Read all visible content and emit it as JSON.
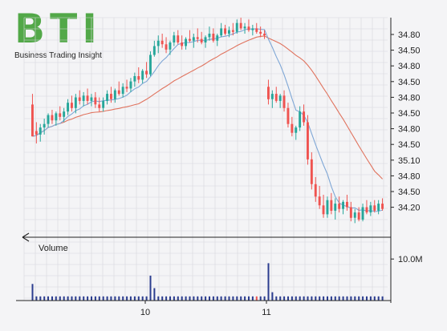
{
  "brand": {
    "logo_text": "BTI",
    "tagline": "Business Trading Insight",
    "logo_color": "#52a848"
  },
  "colors": {
    "background": "#f4f4f6",
    "grid": "#d6d6dc",
    "up_candle": "#26a69a",
    "down_candle": "#ef5350",
    "sma_fast": "#7fa7d6",
    "sma_slow": "#e0735e",
    "volume_bar": "#2b3d8f",
    "volume_bar_down": "#ef5350",
    "axis_line": "#222222"
  },
  "chart_data": {
    "type": "candlestick",
    "price_axis": {
      "tick_labels": [
        "34.80",
        "34.50",
        "34.80",
        "34.50",
        "34.80",
        "34.50",
        "34.80",
        "34.50",
        "35.10",
        "34.80",
        "34.50",
        "34.20"
      ],
      "ylim": [
        0,
        11
      ]
    },
    "x_axis": {
      "tick_labels": [
        "10",
        "11"
      ],
      "tick_positions": [
        40,
        80
      ],
      "xlim": [
        0,
        120
      ]
    },
    "volume_panel": {
      "label": "Volume",
      "tick_label": "10.0M",
      "tick_value": 10.0
    },
    "candles": [
      [
        7.0,
        7.6,
        5.5,
        5.2
      ],
      [
        5.5,
        6.0,
        4.8,
        5.3
      ],
      [
        5.3,
        5.9,
        4.9,
        5.7
      ],
      [
        5.7,
        6.2,
        5.3,
        5.9
      ],
      [
        5.9,
        6.5,
        5.7,
        6.4
      ],
      [
        6.4,
        6.7,
        5.9,
        6.1
      ],
      [
        6.1,
        6.6,
        5.8,
        6.5
      ],
      [
        6.5,
        6.9,
        6.1,
        6.3
      ],
      [
        6.3,
        6.8,
        6.0,
        6.6
      ],
      [
        6.6,
        7.3,
        6.4,
        7.1
      ],
      [
        7.1,
        7.5,
        6.6,
        6.8
      ],
      [
        6.8,
        7.6,
        6.5,
        7.4
      ],
      [
        7.4,
        7.8,
        7.0,
        7.2
      ],
      [
        7.2,
        7.7,
        6.9,
        7.5
      ],
      [
        7.5,
        7.9,
        7.0,
        7.2
      ],
      [
        7.2,
        7.6,
        6.9,
        7.4
      ],
      [
        7.4,
        7.7,
        6.8,
        7.0
      ],
      [
        7.0,
        7.4,
        6.6,
        6.8
      ],
      [
        6.8,
        7.4,
        6.6,
        7.2
      ],
      [
        7.2,
        7.8,
        7.0,
        7.6
      ],
      [
        7.6,
        8.0,
        7.1,
        7.3
      ],
      [
        7.3,
        7.9,
        7.1,
        7.8
      ],
      [
        7.8,
        8.3,
        7.5,
        7.6
      ],
      [
        7.6,
        8.2,
        7.4,
        8.0
      ],
      [
        8.0,
        8.4,
        7.7,
        7.9
      ],
      [
        7.9,
        8.5,
        7.7,
        8.3
      ],
      [
        8.3,
        8.8,
        8.0,
        8.6
      ],
      [
        8.6,
        9.1,
        8.2,
        8.4
      ],
      [
        8.4,
        9.0,
        8.2,
        8.9
      ],
      [
        8.9,
        9.4,
        8.5,
        8.7
      ],
      [
        8.7,
        10.0,
        8.6,
        9.8
      ],
      [
        9.8,
        10.6,
        9.7,
        10.3
      ],
      [
        10.3,
        10.9,
        9.9,
        10.6
      ],
      [
        10.6,
        11.0,
        10.2,
        10.4
      ],
      [
        10.4,
        10.8,
        9.9,
        10.1
      ],
      [
        10.1,
        10.6,
        9.8,
        10.5
      ],
      [
        10.5,
        11.1,
        10.3,
        10.9
      ],
      [
        10.9,
        11.2,
        10.4,
        10.5
      ],
      [
        10.5,
        10.9,
        10.1,
        10.3
      ],
      [
        10.3,
        10.8,
        10.1,
        10.7
      ],
      [
        10.7,
        11.2,
        10.5,
        10.6
      ],
      [
        10.6,
        11.0,
        10.2,
        10.8
      ],
      [
        10.8,
        11.3,
        10.5,
        10.7
      ],
      [
        10.7,
        11.1,
        10.4,
        10.5
      ],
      [
        10.5,
        10.9,
        10.2,
        10.8
      ],
      [
        10.8,
        11.4,
        10.6,
        11.0
      ],
      [
        11.0,
        11.3,
        10.5,
        10.6
      ],
      [
        10.6,
        11.0,
        10.3,
        10.9
      ],
      [
        10.9,
        11.6,
        10.8,
        11.3
      ],
      [
        11.3,
        11.5,
        10.9,
        11.0
      ],
      [
        11.0,
        11.4,
        10.8,
        11.2
      ],
      [
        11.2,
        11.6,
        10.9,
        11.1
      ],
      [
        11.1,
        11.8,
        11.0,
        11.6
      ],
      [
        11.6,
        11.9,
        11.2,
        11.3
      ],
      [
        11.3,
        11.6,
        11.0,
        11.4
      ],
      [
        11.4,
        11.8,
        11.1,
        11.2
      ],
      [
        11.2,
        11.5,
        10.9,
        11.3
      ],
      [
        11.3,
        11.6,
        11.0,
        11.1
      ],
      [
        11.1,
        11.4,
        10.8,
        11.0
      ],
      [
        11.0,
        11.2,
        10.7,
        10.9
      ],
      [
        8.0,
        8.4,
        7.0,
        7.3
      ],
      [
        7.3,
        7.8,
        6.8,
        7.6
      ],
      [
        7.6,
        8.0,
        7.1,
        7.2
      ],
      [
        7.2,
        7.6,
        6.8,
        7.5
      ],
      [
        7.5,
        7.8,
        6.6,
        6.8
      ],
      [
        6.8,
        7.1,
        5.7,
        5.9
      ],
      [
        5.9,
        6.3,
        5.2,
        5.4
      ],
      [
        5.4,
        5.8,
        5.0,
        5.7
      ],
      [
        5.7,
        6.9,
        5.5,
        6.6
      ],
      [
        6.6,
        7.0,
        5.8,
        6.0
      ],
      [
        6.0,
        6.4,
        3.6,
        3.9
      ],
      [
        3.9,
        4.3,
        2.2,
        2.5
      ],
      [
        2.5,
        2.9,
        1.5,
        1.8
      ],
      [
        1.8,
        2.4,
        1.1,
        1.3
      ],
      [
        1.3,
        1.9,
        0.6,
        0.8
      ],
      [
        0.8,
        1.8,
        0.6,
        1.6
      ],
      [
        1.6,
        2.0,
        0.8,
        1.0
      ],
      [
        1.0,
        1.7,
        0.5,
        1.4
      ],
      [
        1.4,
        1.8,
        0.9,
        1.1
      ],
      [
        1.1,
        1.6,
        0.8,
        1.5
      ],
      [
        1.5,
        1.9,
        1.0,
        1.2
      ],
      [
        1.2,
        1.5,
        0.4,
        0.6
      ],
      [
        0.6,
        1.1,
        0.3,
        0.9
      ],
      [
        0.9,
        1.2,
        0.4,
        0.5
      ],
      [
        0.5,
        1.4,
        0.4,
        1.2
      ],
      [
        1.2,
        1.6,
        0.8,
        0.9
      ],
      [
        0.9,
        1.5,
        0.7,
        1.3
      ],
      [
        1.3,
        1.6,
        0.9,
        1.0
      ],
      [
        1.0,
        1.6,
        0.8,
        1.4
      ],
      [
        1.4,
        1.7,
        1.0,
        1.1
      ]
    ],
    "volume": [
      4,
      1,
      1,
      1,
      1,
      1,
      1,
      1,
      1,
      1,
      1,
      1,
      1,
      1,
      1,
      1,
      1,
      1,
      1,
      1,
      1,
      1,
      1,
      1,
      1,
      1,
      1,
      1,
      1,
      1,
      6,
      3,
      1,
      1,
      1,
      1,
      1,
      1,
      1,
      1,
      1,
      1,
      1,
      1,
      1,
      1,
      1,
      1,
      1,
      1,
      1,
      1,
      1,
      1,
      1,
      1,
      1,
      1,
      1,
      1,
      9,
      2,
      1,
      1,
      1,
      1,
      1,
      1,
      1,
      1,
      1,
      1,
      1,
      1,
      1,
      1,
      1,
      1,
      1,
      1,
      1,
      1,
      1,
      1,
      1,
      1,
      1,
      1,
      1,
      1
    ]
  }
}
